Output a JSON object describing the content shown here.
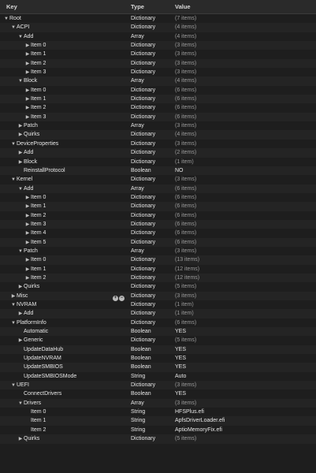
{
  "columns": {
    "key": "Key",
    "type": "Type",
    "value": "Value"
  },
  "rows": [
    {
      "key": "Root",
      "type": "Dictionary",
      "value": "(7 items)",
      "depth": 0,
      "tri": "open"
    },
    {
      "key": "ACPI",
      "type": "Dictionary",
      "value": "(4 items)",
      "depth": 1,
      "tri": "open"
    },
    {
      "key": "Add",
      "type": "Array",
      "value": "(4 items)",
      "depth": 2,
      "tri": "open"
    },
    {
      "key": "Item 0",
      "type": "Dictionary",
      "value": "(3 items)",
      "depth": 3,
      "tri": "closed"
    },
    {
      "key": "Item 1",
      "type": "Dictionary",
      "value": "(3 items)",
      "depth": 3,
      "tri": "closed"
    },
    {
      "key": "Item 2",
      "type": "Dictionary",
      "value": "(3 items)",
      "depth": 3,
      "tri": "closed"
    },
    {
      "key": "Item 3",
      "type": "Dictionary",
      "value": "(3 items)",
      "depth": 3,
      "tri": "closed"
    },
    {
      "key": "Block",
      "type": "Array",
      "value": "(4 items)",
      "depth": 2,
      "tri": "open"
    },
    {
      "key": "Item 0",
      "type": "Dictionary",
      "value": "(6 items)",
      "depth": 3,
      "tri": "closed"
    },
    {
      "key": "Item 1",
      "type": "Dictionary",
      "value": "(6 items)",
      "depth": 3,
      "tri": "closed"
    },
    {
      "key": "Item 2",
      "type": "Dictionary",
      "value": "(6 items)",
      "depth": 3,
      "tri": "closed"
    },
    {
      "key": "Item 3",
      "type": "Dictionary",
      "value": "(6 items)",
      "depth": 3,
      "tri": "closed"
    },
    {
      "key": "Patch",
      "type": "Array",
      "value": "(3 items)",
      "depth": 2,
      "tri": "closed"
    },
    {
      "key": "Quirks",
      "type": "Dictionary",
      "value": "(4 items)",
      "depth": 2,
      "tri": "closed"
    },
    {
      "key": "DeviceProperties",
      "type": "Dictionary",
      "value": "(3 items)",
      "depth": 1,
      "tri": "open"
    },
    {
      "key": "Add",
      "type": "Dictionary",
      "value": "(2 items)",
      "depth": 2,
      "tri": "closed"
    },
    {
      "key": "Block",
      "type": "Dictionary",
      "value": "(1 item)",
      "depth": 2,
      "tri": "closed"
    },
    {
      "key": "ReinstallProtocol",
      "type": "Boolean",
      "value": "NO",
      "depth": 2,
      "tri": "none"
    },
    {
      "key": "Kernel",
      "type": "Dictionary",
      "value": "(3 items)",
      "depth": 1,
      "tri": "open"
    },
    {
      "key": "Add",
      "type": "Array",
      "value": "(6 items)",
      "depth": 2,
      "tri": "open"
    },
    {
      "key": "Item 0",
      "type": "Dictionary",
      "value": "(6 items)",
      "depth": 3,
      "tri": "closed"
    },
    {
      "key": "Item 1",
      "type": "Dictionary",
      "value": "(6 items)",
      "depth": 3,
      "tri": "closed"
    },
    {
      "key": "Item 2",
      "type": "Dictionary",
      "value": "(6 items)",
      "depth": 3,
      "tri": "closed"
    },
    {
      "key": "Item 3",
      "type": "Dictionary",
      "value": "(6 items)",
      "depth": 3,
      "tri": "closed"
    },
    {
      "key": "Item 4",
      "type": "Dictionary",
      "value": "(6 items)",
      "depth": 3,
      "tri": "closed"
    },
    {
      "key": "Item 5",
      "type": "Dictionary",
      "value": "(6 items)",
      "depth": 3,
      "tri": "closed"
    },
    {
      "key": "Patch",
      "type": "Array",
      "value": "(3 items)",
      "depth": 2,
      "tri": "open"
    },
    {
      "key": "Item 0",
      "type": "Dictionary",
      "value": "(13 items)",
      "depth": 3,
      "tri": "closed"
    },
    {
      "key": "Item 1",
      "type": "Dictionary",
      "value": "(12 items)",
      "depth": 3,
      "tri": "closed"
    },
    {
      "key": "Item 2",
      "type": "Dictionary",
      "value": "(12 items)",
      "depth": 3,
      "tri": "closed"
    },
    {
      "key": "Quirks",
      "type": "Dictionary",
      "value": "(5 items)",
      "depth": 2,
      "tri": "closed"
    },
    {
      "key": "Misc",
      "type": "Dictionary",
      "value": "(3 items)",
      "depth": 1,
      "tri": "closed",
      "controls": true
    },
    {
      "key": "NVRAM",
      "type": "Dictionary",
      "value": "(1 item)",
      "depth": 1,
      "tri": "open"
    },
    {
      "key": "Add",
      "type": "Dictionary",
      "value": "(1 item)",
      "depth": 2,
      "tri": "closed"
    },
    {
      "key": "PlatformInfo",
      "type": "Dictionary",
      "value": "(6 items)",
      "depth": 1,
      "tri": "open"
    },
    {
      "key": "Automatic",
      "type": "Boolean",
      "value": "YES",
      "depth": 2,
      "tri": "none"
    },
    {
      "key": "Generic",
      "type": "Dictionary",
      "value": "(5 items)",
      "depth": 2,
      "tri": "closed"
    },
    {
      "key": "UpdateDataHub",
      "type": "Boolean",
      "value": "YES",
      "depth": 2,
      "tri": "none"
    },
    {
      "key": "UpdateNVRAM",
      "type": "Boolean",
      "value": "YES",
      "depth": 2,
      "tri": "none"
    },
    {
      "key": "UpdateSMBIOS",
      "type": "Boolean",
      "value": "YES",
      "depth": 2,
      "tri": "none"
    },
    {
      "key": "UpdateSMBIOSMode",
      "type": "String",
      "value": "Auto",
      "depth": 2,
      "tri": "none"
    },
    {
      "key": "UEFI",
      "type": "Dictionary",
      "value": "(3 items)",
      "depth": 1,
      "tri": "open"
    },
    {
      "key": "ConnectDrivers",
      "type": "Boolean",
      "value": "YES",
      "depth": 2,
      "tri": "none"
    },
    {
      "key": "Drivers",
      "type": "Array",
      "value": "(3 items)",
      "depth": 2,
      "tri": "open"
    },
    {
      "key": "Item 0",
      "type": "String",
      "value": "HFSPlus.efi",
      "depth": 3,
      "tri": "none"
    },
    {
      "key": "Item 1",
      "type": "String",
      "value": "ApfsDriverLoader.efi",
      "depth": 3,
      "tri": "none"
    },
    {
      "key": "Item 2",
      "type": "String",
      "value": "AptioMemoryFix.efi",
      "depth": 3,
      "tri": "none"
    },
    {
      "key": "Quirks",
      "type": "Dictionary",
      "value": "(5 items)",
      "depth": 2,
      "tri": "closed"
    }
  ],
  "controls": {
    "add": "+",
    "remove": "−"
  }
}
